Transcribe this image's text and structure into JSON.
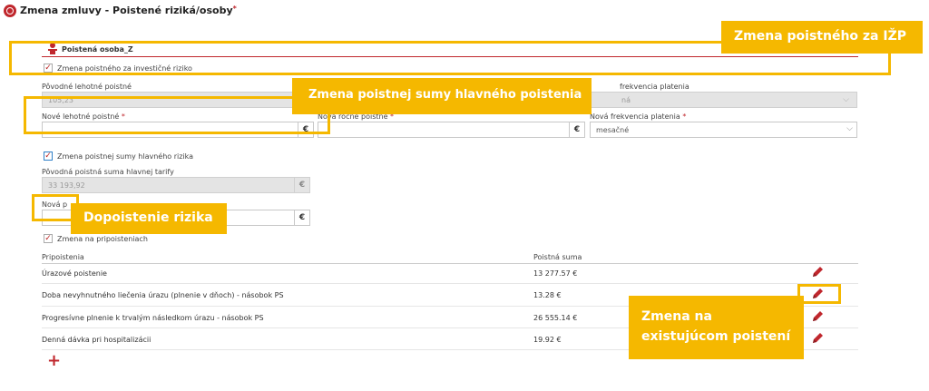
{
  "header": {
    "title": "Zmena zmluvy - Poistené riziká/osoby",
    "required_mark": "*"
  },
  "person": {
    "label": "Poistená osoba_Z"
  },
  "investment": {
    "checkbox_label": "Zmena poistného za investičné riziko",
    "orig_premium_label": "Pôvodné lehotné poistné",
    "orig_premium_value": "105,23",
    "frequency_label_top": "frekvencia platenia",
    "frequency_value_top": "ná",
    "new_premium_label": "Nové lehotné poistné",
    "new_annual_label": "Nová ročné poistné",
    "new_frequency_label": "Nová frekvencia platenia",
    "new_frequency_value": "mesačné",
    "currency": "€",
    "required_mark": "*"
  },
  "main_sum": {
    "checkbox_label": "Zmena poistnej sumy hlavného rizika",
    "orig_sum_label": "Pôvodná poistná suma hlavnej tarify",
    "orig_sum_value": "33 193,92",
    "new_sum_label": "Nová p",
    "currency": "€"
  },
  "riders": {
    "checkbox_label": "Zmena na pripoisteniach",
    "col_name": "Pripoistenia",
    "col_sum": "Poistná suma",
    "rows": [
      {
        "name": "Úrazové poistenie",
        "sum": "13 277.57 €"
      },
      {
        "name": "Doba nevyhnutného liečenia úrazu (plnenie v dňoch) - násobok PS",
        "sum": "13.28 €"
      },
      {
        "name": "Progresívne plnenie k trvalým následkom úrazu - násobok PS",
        "sum": "26 555.14 €"
      },
      {
        "name": "Denná dávka pri hospitalizácii",
        "sum": "19.92 €"
      }
    ],
    "add_symbol": "+"
  },
  "callouts": {
    "izp": "Zmena poistného za IŽP",
    "main_sum": "Zmena poistnej sumy hlavného poistenia",
    "rider_add": "Dopoistenie rizika",
    "existing_line1": "Zmena na",
    "existing_line2": "existujúcom poistení"
  },
  "colors": {
    "accent_red": "#c0272d",
    "callout_yellow": "#f5b800"
  }
}
